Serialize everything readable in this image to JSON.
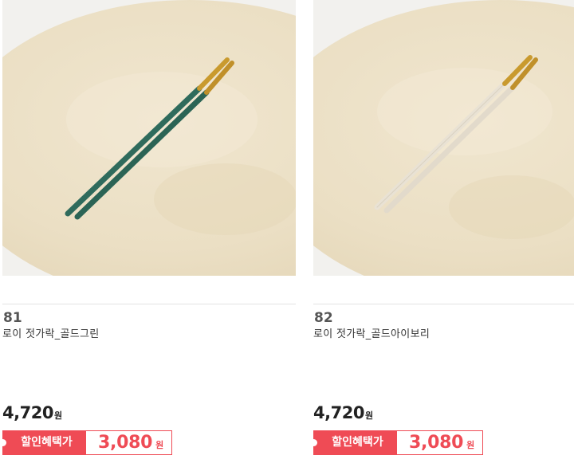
{
  "products": [
    {
      "rank": "81",
      "name": "로이 젓가락_골드그린",
      "price": "4,720",
      "price_unit": "원",
      "sale_label": "할인혜택가",
      "sale_price": "3,080",
      "sale_unit": "원",
      "chopstick_color": "#2f6b5c",
      "tip_color": "#c99a2e"
    },
    {
      "rank": "82",
      "name": "로이 젓가락_골드아이보리",
      "price": "4,720",
      "price_unit": "원",
      "sale_label": "할인혜택가",
      "sale_price": "3,080",
      "sale_unit": "원",
      "chopstick_color": "#e9e2d4",
      "tip_color": "#c99a2e"
    }
  ],
  "colors": {
    "accent": "#ef4b55",
    "placemat": "#ede2c9",
    "background": "#f2f1ee"
  }
}
